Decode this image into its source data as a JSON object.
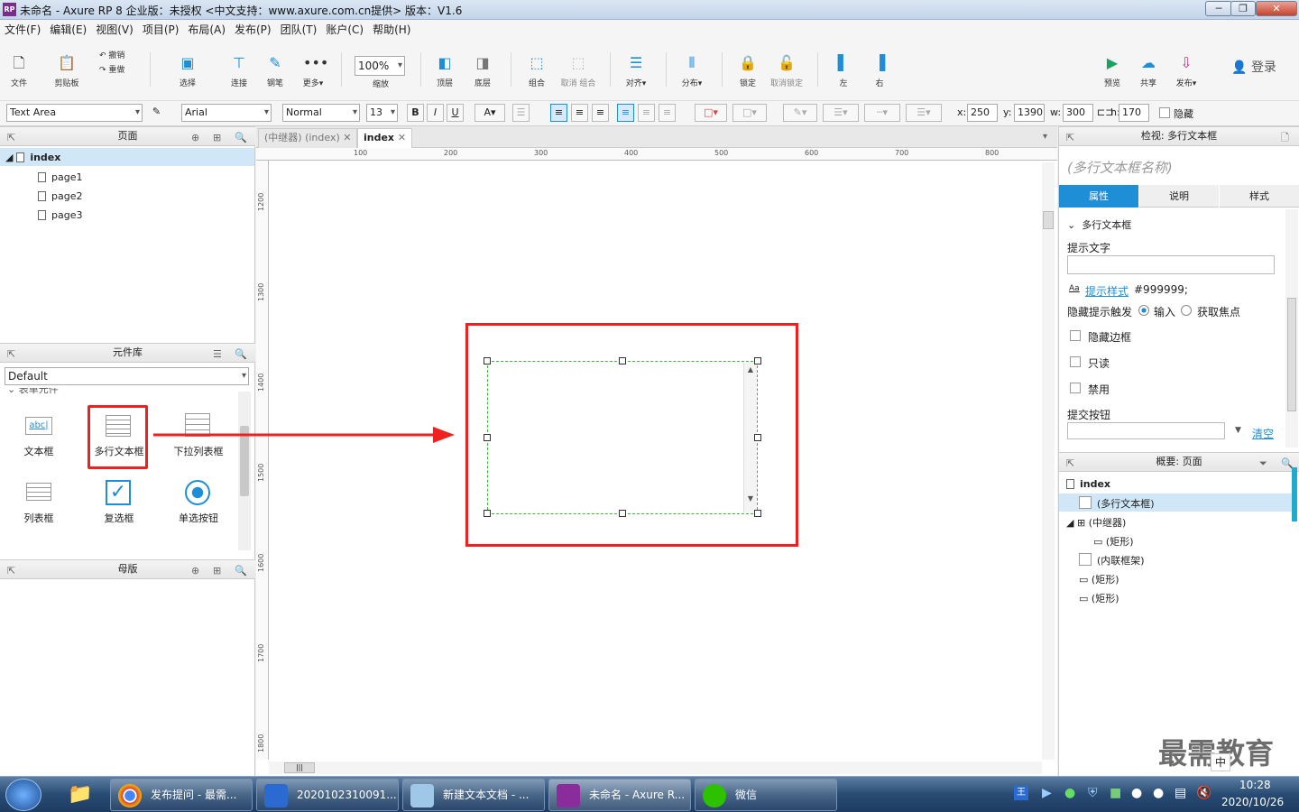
{
  "window": {
    "title": "未命名 - Axure RP 8 企业版：未授权      <中文支持：www.axure.com.cn提供> 版本：V1.6",
    "logo": "RP"
  },
  "menu": [
    "文件(F)",
    "编辑(E)",
    "视图(V)",
    "项目(P)",
    "布局(A)",
    "发布(P)",
    "团队(T)",
    "账户(C)",
    "帮助(H)"
  ],
  "toolbar": {
    "file": "文件",
    "clipboard": "剪贴板",
    "undo": "撤销",
    "redo": "重做",
    "select": "选择",
    "connect": "连接",
    "pen": "钢笔",
    "more": "更多▾",
    "zoom": "100%",
    "zoom_label": "缩放",
    "top": "顶层",
    "bottom": "底层",
    "group": "组合",
    "ungroup": "取消 组合",
    "align": "对齐▾",
    "distribute": "分布▾",
    "lock": "锁定",
    "unlock": "取消锁定",
    "left": "左",
    "right": "右",
    "preview": "预览",
    "share": "共享",
    "publish": "发布▾",
    "login": "登录"
  },
  "format": {
    "widget_type": "Text Area",
    "font": "Arial",
    "style": "Normal",
    "size": "13",
    "bold": "B",
    "italic": "I",
    "underline": "U",
    "x_label": "x:",
    "x": "250",
    "y_label": "y:",
    "y": "1390",
    "w_label": "w:",
    "w": "300",
    "h_label": "h:",
    "h": "170",
    "hide": "隐藏"
  },
  "pages": {
    "header": "页面",
    "root": "index",
    "items": [
      "page1",
      "page2",
      "page3"
    ]
  },
  "library": {
    "header": "元件库",
    "selected": "Default",
    "group": "表单元件",
    "widgets": [
      "文本框",
      "多行文本框",
      "下拉列表框",
      "列表框",
      "复选框",
      "单选按钮"
    ]
  },
  "masters": {
    "header": "母版"
  },
  "tabs": [
    "(中继器) (index)",
    "index"
  ],
  "ruler": {
    "h": [
      "100",
      "200",
      "300",
      "400",
      "500",
      "600",
      "700",
      "800"
    ],
    "v": [
      "1200",
      "1300",
      "1400",
      "1500",
      "1600",
      "1700",
      "1800"
    ]
  },
  "inspector": {
    "title": "检视: 多行文本框",
    "name_placeholder": "(多行文本框名称)",
    "tabs": [
      "属性",
      "说明",
      "样式"
    ],
    "section": "多行文本框",
    "hint_label": "提示文字",
    "hint_style_link": "提示样式",
    "hint_color": "#999999;",
    "hide_trigger_label": "隐藏提示触发",
    "radio_input": "输入",
    "radio_focus": "获取焦点",
    "hide_border": "隐藏边框",
    "readonly": "只读",
    "disabled": "禁用",
    "submit_label": "提交按钮",
    "clear": "清空"
  },
  "outline": {
    "title": "概要: 页面",
    "root": "index",
    "items": [
      "(多行文本框)",
      "(中继器)",
      "(矩形)",
      "(内联框架)",
      "(矩形)",
      "(矩形)"
    ]
  },
  "taskbar": {
    "items": [
      "发布提问 - 最需...",
      "2020102310091...",
      "新建文本文档 - ...",
      "未命名 - Axure R...",
      "微信"
    ],
    "time": "10:28",
    "date": "2020/10/26",
    "ime": "中"
  },
  "watermark": "最需教育",
  "colors": {
    "accent": "#1e8fd6",
    "highlight": "#f02020",
    "selection": "#33bb33"
  }
}
